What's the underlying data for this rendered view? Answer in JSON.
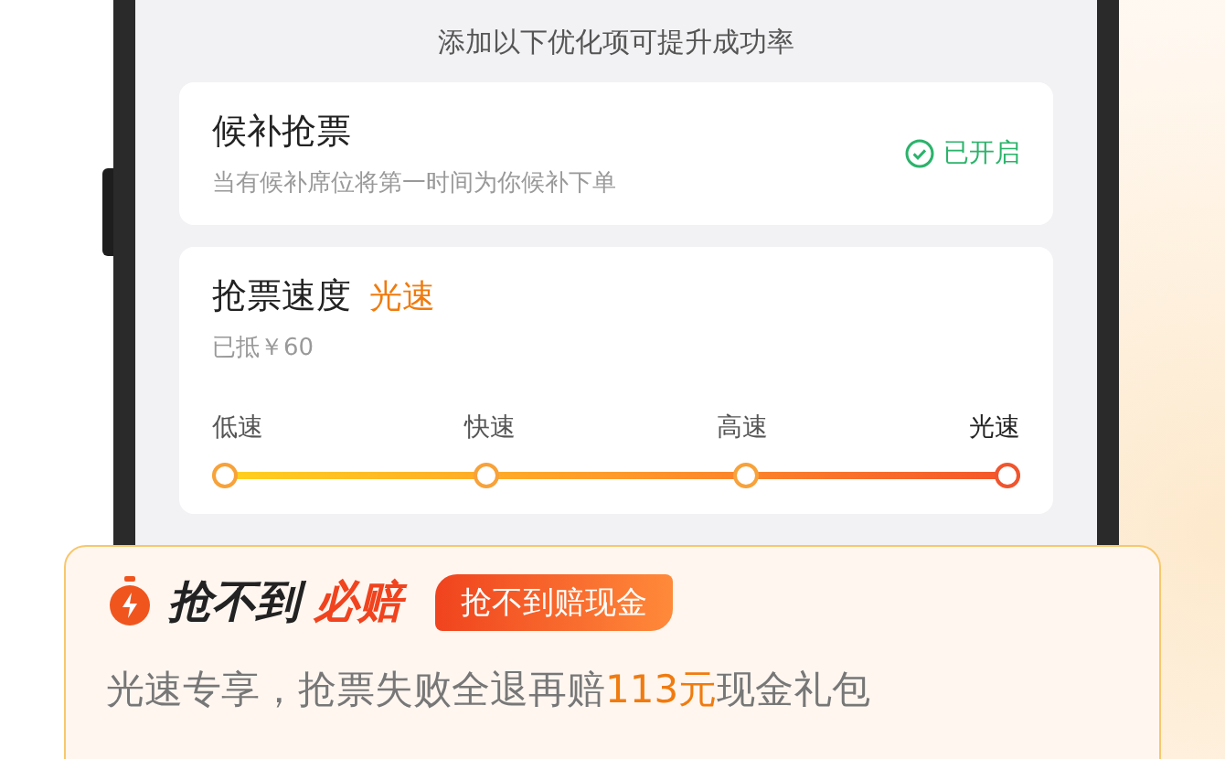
{
  "header": {
    "title": "添加以下优化项可提升成功率"
  },
  "waitlist": {
    "title": "候补抢票",
    "subtitle": "当有候补席位将第一时间为你候补下单",
    "enabled": true,
    "status": "已开启"
  },
  "speed": {
    "title": "抢票速度",
    "current": "光速",
    "discount": "已抵￥60",
    "stops": [
      {
        "label": "低速",
        "selected": false
      },
      {
        "label": "快速",
        "selected": false
      },
      {
        "label": "高速",
        "selected": false
      },
      {
        "label": "光速",
        "selected": true
      }
    ]
  },
  "banner": {
    "title_dark": "抢不到",
    "title_red": "必赔",
    "tag": "抢不到赔现金",
    "text_before": "光速专享，抢票失败全退再赔",
    "highlight": "113元",
    "text_after": "现金礼包"
  }
}
